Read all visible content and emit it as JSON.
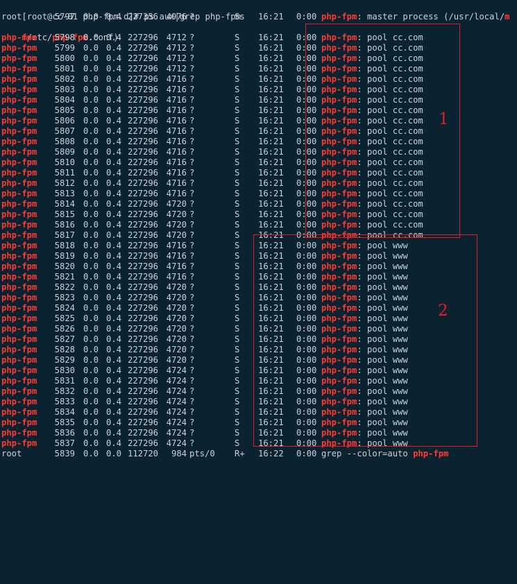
{
  "terminal": {
    "prompt": "[root@cc-01 php-fpm.d]# ",
    "command": "ps aux|grep php-fpm",
    "highlight_word": "php-fpm",
    "master": {
      "user": "root",
      "pid": "5797",
      "cpu": "0.0",
      "mem": "0.4",
      "vsz": "227356",
      "rss": "4976",
      "tty": "?",
      "stat": "Ss",
      "start": "16:21",
      "time": "0:00",
      "cmd_prefix": "php-fpm",
      "cmd_rest": ": master process (/usr/local/",
      "wrap_start": "m",
      "wrap_mid": "/etc/",
      "wrap_word": "php-fpm",
      "wrap_end": ".conf)"
    },
    "rows": [
      {
        "user": "php-fpm",
        "pid": "5798",
        "cpu": "0.0",
        "mem": "0.4",
        "vsz": "227296",
        "rss": "4712",
        "tty": "?",
        "stat": "S",
        "start": "16:21",
        "time": "0:00",
        "cmd": "php-fpm",
        "pool": ": pool cc.com"
      },
      {
        "user": "php-fpm",
        "pid": "5799",
        "cpu": "0.0",
        "mem": "0.4",
        "vsz": "227296",
        "rss": "4712",
        "tty": "?",
        "stat": "S",
        "start": "16:21",
        "time": "0:00",
        "cmd": "php-fpm",
        "pool": ": pool cc.com"
      },
      {
        "user": "php-fpm",
        "pid": "5800",
        "cpu": "0.0",
        "mem": "0.4",
        "vsz": "227296",
        "rss": "4712",
        "tty": "?",
        "stat": "S",
        "start": "16:21",
        "time": "0:00",
        "cmd": "php-fpm",
        "pool": ": pool cc.com"
      },
      {
        "user": "php-fpm",
        "pid": "5801",
        "cpu": "0.0",
        "mem": "0.4",
        "vsz": "227296",
        "rss": "4712",
        "tty": "?",
        "stat": "S",
        "start": "16:21",
        "time": "0:00",
        "cmd": "php-fpm",
        "pool": ": pool cc.com"
      },
      {
        "user": "php-fpm",
        "pid": "5802",
        "cpu": "0.0",
        "mem": "0.4",
        "vsz": "227296",
        "rss": "4716",
        "tty": "?",
        "stat": "S",
        "start": "16:21",
        "time": "0:00",
        "cmd": "php-fpm",
        "pool": ": pool cc.com"
      },
      {
        "user": "php-fpm",
        "pid": "5803",
        "cpu": "0.0",
        "mem": "0.4",
        "vsz": "227296",
        "rss": "4716",
        "tty": "?",
        "stat": "S",
        "start": "16:21",
        "time": "0:00",
        "cmd": "php-fpm",
        "pool": ": pool cc.com"
      },
      {
        "user": "php-fpm",
        "pid": "5804",
        "cpu": "0.0",
        "mem": "0.4",
        "vsz": "227296",
        "rss": "4716",
        "tty": "?",
        "stat": "S",
        "start": "16:21",
        "time": "0:00",
        "cmd": "php-fpm",
        "pool": ": pool cc.com"
      },
      {
        "user": "php-fpm",
        "pid": "5805",
        "cpu": "0.0",
        "mem": "0.4",
        "vsz": "227296",
        "rss": "4716",
        "tty": "?",
        "stat": "S",
        "start": "16:21",
        "time": "0:00",
        "cmd": "php-fpm",
        "pool": ": pool cc.com"
      },
      {
        "user": "php-fpm",
        "pid": "5806",
        "cpu": "0.0",
        "mem": "0.4",
        "vsz": "227296",
        "rss": "4716",
        "tty": "?",
        "stat": "S",
        "start": "16:21",
        "time": "0:00",
        "cmd": "php-fpm",
        "pool": ": pool cc.com"
      },
      {
        "user": "php-fpm",
        "pid": "5807",
        "cpu": "0.0",
        "mem": "0.4",
        "vsz": "227296",
        "rss": "4716",
        "tty": "?",
        "stat": "S",
        "start": "16:21",
        "time": "0:00",
        "cmd": "php-fpm",
        "pool": ": pool cc.com"
      },
      {
        "user": "php-fpm",
        "pid": "5808",
        "cpu": "0.0",
        "mem": "0.4",
        "vsz": "227296",
        "rss": "4716",
        "tty": "?",
        "stat": "S",
        "start": "16:21",
        "time": "0:00",
        "cmd": "php-fpm",
        "pool": ": pool cc.com"
      },
      {
        "user": "php-fpm",
        "pid": "5809",
        "cpu": "0.0",
        "mem": "0.4",
        "vsz": "227296",
        "rss": "4716",
        "tty": "?",
        "stat": "S",
        "start": "16:21",
        "time": "0:00",
        "cmd": "php-fpm",
        "pool": ": pool cc.com"
      },
      {
        "user": "php-fpm",
        "pid": "5810",
        "cpu": "0.0",
        "mem": "0.4",
        "vsz": "227296",
        "rss": "4716",
        "tty": "?",
        "stat": "S",
        "start": "16:21",
        "time": "0:00",
        "cmd": "php-fpm",
        "pool": ": pool cc.com"
      },
      {
        "user": "php-fpm",
        "pid": "5811",
        "cpu": "0.0",
        "mem": "0.4",
        "vsz": "227296",
        "rss": "4716",
        "tty": "?",
        "stat": "S",
        "start": "16:21",
        "time": "0:00",
        "cmd": "php-fpm",
        "pool": ": pool cc.com"
      },
      {
        "user": "php-fpm",
        "pid": "5812",
        "cpu": "0.0",
        "mem": "0.4",
        "vsz": "227296",
        "rss": "4716",
        "tty": "?",
        "stat": "S",
        "start": "16:21",
        "time": "0:00",
        "cmd": "php-fpm",
        "pool": ": pool cc.com"
      },
      {
        "user": "php-fpm",
        "pid": "5813",
        "cpu": "0.0",
        "mem": "0.4",
        "vsz": "227296",
        "rss": "4716",
        "tty": "?",
        "stat": "S",
        "start": "16:21",
        "time": "0:00",
        "cmd": "php-fpm",
        "pool": ": pool cc.com"
      },
      {
        "user": "php-fpm",
        "pid": "5814",
        "cpu": "0.0",
        "mem": "0.4",
        "vsz": "227296",
        "rss": "4720",
        "tty": "?",
        "stat": "S",
        "start": "16:21",
        "time": "0:00",
        "cmd": "php-fpm",
        "pool": ": pool cc.com"
      },
      {
        "user": "php-fpm",
        "pid": "5815",
        "cpu": "0.0",
        "mem": "0.4",
        "vsz": "227296",
        "rss": "4720",
        "tty": "?",
        "stat": "S",
        "start": "16:21",
        "time": "0:00",
        "cmd": "php-fpm",
        "pool": ": pool cc.com"
      },
      {
        "user": "php-fpm",
        "pid": "5816",
        "cpu": "0.0",
        "mem": "0.4",
        "vsz": "227296",
        "rss": "4720",
        "tty": "?",
        "stat": "S",
        "start": "16:21",
        "time": "0:00",
        "cmd": "php-fpm",
        "pool": ": pool cc.com"
      },
      {
        "user": "php-fpm",
        "pid": "5817",
        "cpu": "0.0",
        "mem": "0.4",
        "vsz": "227296",
        "rss": "4720",
        "tty": "?",
        "stat": "S",
        "start": "16:21",
        "time": "0:00",
        "cmd": "php-fpm",
        "pool": ": pool cc.com"
      },
      {
        "user": "php-fpm",
        "pid": "5818",
        "cpu": "0.0",
        "mem": "0.4",
        "vsz": "227296",
        "rss": "4716",
        "tty": "?",
        "stat": "S",
        "start": "16:21",
        "time": "0:00",
        "cmd": "php-fpm",
        "pool": ": pool www"
      },
      {
        "user": "php-fpm",
        "pid": "5819",
        "cpu": "0.0",
        "mem": "0.4",
        "vsz": "227296",
        "rss": "4716",
        "tty": "?",
        "stat": "S",
        "start": "16:21",
        "time": "0:00",
        "cmd": "php-fpm",
        "pool": ": pool www"
      },
      {
        "user": "php-fpm",
        "pid": "5820",
        "cpu": "0.0",
        "mem": "0.4",
        "vsz": "227296",
        "rss": "4716",
        "tty": "?",
        "stat": "S",
        "start": "16:21",
        "time": "0:00",
        "cmd": "php-fpm",
        "pool": ": pool www"
      },
      {
        "user": "php-fpm",
        "pid": "5821",
        "cpu": "0.0",
        "mem": "0.4",
        "vsz": "227296",
        "rss": "4716",
        "tty": "?",
        "stat": "S",
        "start": "16:21",
        "time": "0:00",
        "cmd": "php-fpm",
        "pool": ": pool www"
      },
      {
        "user": "php-fpm",
        "pid": "5822",
        "cpu": "0.0",
        "mem": "0.4",
        "vsz": "227296",
        "rss": "4720",
        "tty": "?",
        "stat": "S",
        "start": "16:21",
        "time": "0:00",
        "cmd": "php-fpm",
        "pool": ": pool www"
      },
      {
        "user": "php-fpm",
        "pid": "5823",
        "cpu": "0.0",
        "mem": "0.4",
        "vsz": "227296",
        "rss": "4720",
        "tty": "?",
        "stat": "S",
        "start": "16:21",
        "time": "0:00",
        "cmd": "php-fpm",
        "pool": ": pool www"
      },
      {
        "user": "php-fpm",
        "pid": "5824",
        "cpu": "0.0",
        "mem": "0.4",
        "vsz": "227296",
        "rss": "4720",
        "tty": "?",
        "stat": "S",
        "start": "16:21",
        "time": "0:00",
        "cmd": "php-fpm",
        "pool": ": pool www"
      },
      {
        "user": "php-fpm",
        "pid": "5825",
        "cpu": "0.0",
        "mem": "0.4",
        "vsz": "227296",
        "rss": "4720",
        "tty": "?",
        "stat": "S",
        "start": "16:21",
        "time": "0:00",
        "cmd": "php-fpm",
        "pool": ": pool www"
      },
      {
        "user": "php-fpm",
        "pid": "5826",
        "cpu": "0.0",
        "mem": "0.4",
        "vsz": "227296",
        "rss": "4720",
        "tty": "?",
        "stat": "S",
        "start": "16:21",
        "time": "0:00",
        "cmd": "php-fpm",
        "pool": ": pool www"
      },
      {
        "user": "php-fpm",
        "pid": "5827",
        "cpu": "0.0",
        "mem": "0.4",
        "vsz": "227296",
        "rss": "4720",
        "tty": "?",
        "stat": "S",
        "start": "16:21",
        "time": "0:00",
        "cmd": "php-fpm",
        "pool": ": pool www"
      },
      {
        "user": "php-fpm",
        "pid": "5828",
        "cpu": "0.0",
        "mem": "0.4",
        "vsz": "227296",
        "rss": "4720",
        "tty": "?",
        "stat": "S",
        "start": "16:21",
        "time": "0:00",
        "cmd": "php-fpm",
        "pool": ": pool www"
      },
      {
        "user": "php-fpm",
        "pid": "5829",
        "cpu": "0.0",
        "mem": "0.4",
        "vsz": "227296",
        "rss": "4720",
        "tty": "?",
        "stat": "S",
        "start": "16:21",
        "time": "0:00",
        "cmd": "php-fpm",
        "pool": ": pool www"
      },
      {
        "user": "php-fpm",
        "pid": "5830",
        "cpu": "0.0",
        "mem": "0.4",
        "vsz": "227296",
        "rss": "4724",
        "tty": "?",
        "stat": "S",
        "start": "16:21",
        "time": "0:00",
        "cmd": "php-fpm",
        "pool": ": pool www"
      },
      {
        "user": "php-fpm",
        "pid": "5831",
        "cpu": "0.0",
        "mem": "0.4",
        "vsz": "227296",
        "rss": "4724",
        "tty": "?",
        "stat": "S",
        "start": "16:21",
        "time": "0:00",
        "cmd": "php-fpm",
        "pool": ": pool www"
      },
      {
        "user": "php-fpm",
        "pid": "5832",
        "cpu": "0.0",
        "mem": "0.4",
        "vsz": "227296",
        "rss": "4724",
        "tty": "?",
        "stat": "S",
        "start": "16:21",
        "time": "0:00",
        "cmd": "php-fpm",
        "pool": ": pool www"
      },
      {
        "user": "php-fpm",
        "pid": "5833",
        "cpu": "0.0",
        "mem": "0.4",
        "vsz": "227296",
        "rss": "4724",
        "tty": "?",
        "stat": "S",
        "start": "16:21",
        "time": "0:00",
        "cmd": "php-fpm",
        "pool": ": pool www"
      },
      {
        "user": "php-fpm",
        "pid": "5834",
        "cpu": "0.0",
        "mem": "0.4",
        "vsz": "227296",
        "rss": "4724",
        "tty": "?",
        "stat": "S",
        "start": "16:21",
        "time": "0:00",
        "cmd": "php-fpm",
        "pool": ": pool www"
      },
      {
        "user": "php-fpm",
        "pid": "5835",
        "cpu": "0.0",
        "mem": "0.4",
        "vsz": "227296",
        "rss": "4724",
        "tty": "?",
        "stat": "S",
        "start": "16:21",
        "time": "0:00",
        "cmd": "php-fpm",
        "pool": ": pool www"
      },
      {
        "user": "php-fpm",
        "pid": "5836",
        "cpu": "0.0",
        "mem": "0.4",
        "vsz": "227296",
        "rss": "4724",
        "tty": "?",
        "stat": "S",
        "start": "16:21",
        "time": "0:00",
        "cmd": "php-fpm",
        "pool": ": pool www"
      },
      {
        "user": "php-fpm",
        "pid": "5837",
        "cpu": "0.0",
        "mem": "0.4",
        "vsz": "227296",
        "rss": "4724",
        "tty": "?",
        "stat": "S",
        "start": "16:21",
        "time": "0:00",
        "cmd": "php-fpm",
        "pool": ": pool www"
      }
    ],
    "grep_row": {
      "user": "root",
      "pid": "5839",
      "cpu": "0.0",
      "mem": "0.0",
      "vsz": "112720",
      "rss": "984",
      "tty": "pts/0",
      "stat": "R+",
      "start": "16:22",
      "time": "0:00",
      "cmd_prefix": "grep --color=auto ",
      "cmd_match": "php-fpm"
    }
  },
  "annotations": {
    "box1_label": "1",
    "box2_label": "2",
    "color": "#e02020"
  }
}
